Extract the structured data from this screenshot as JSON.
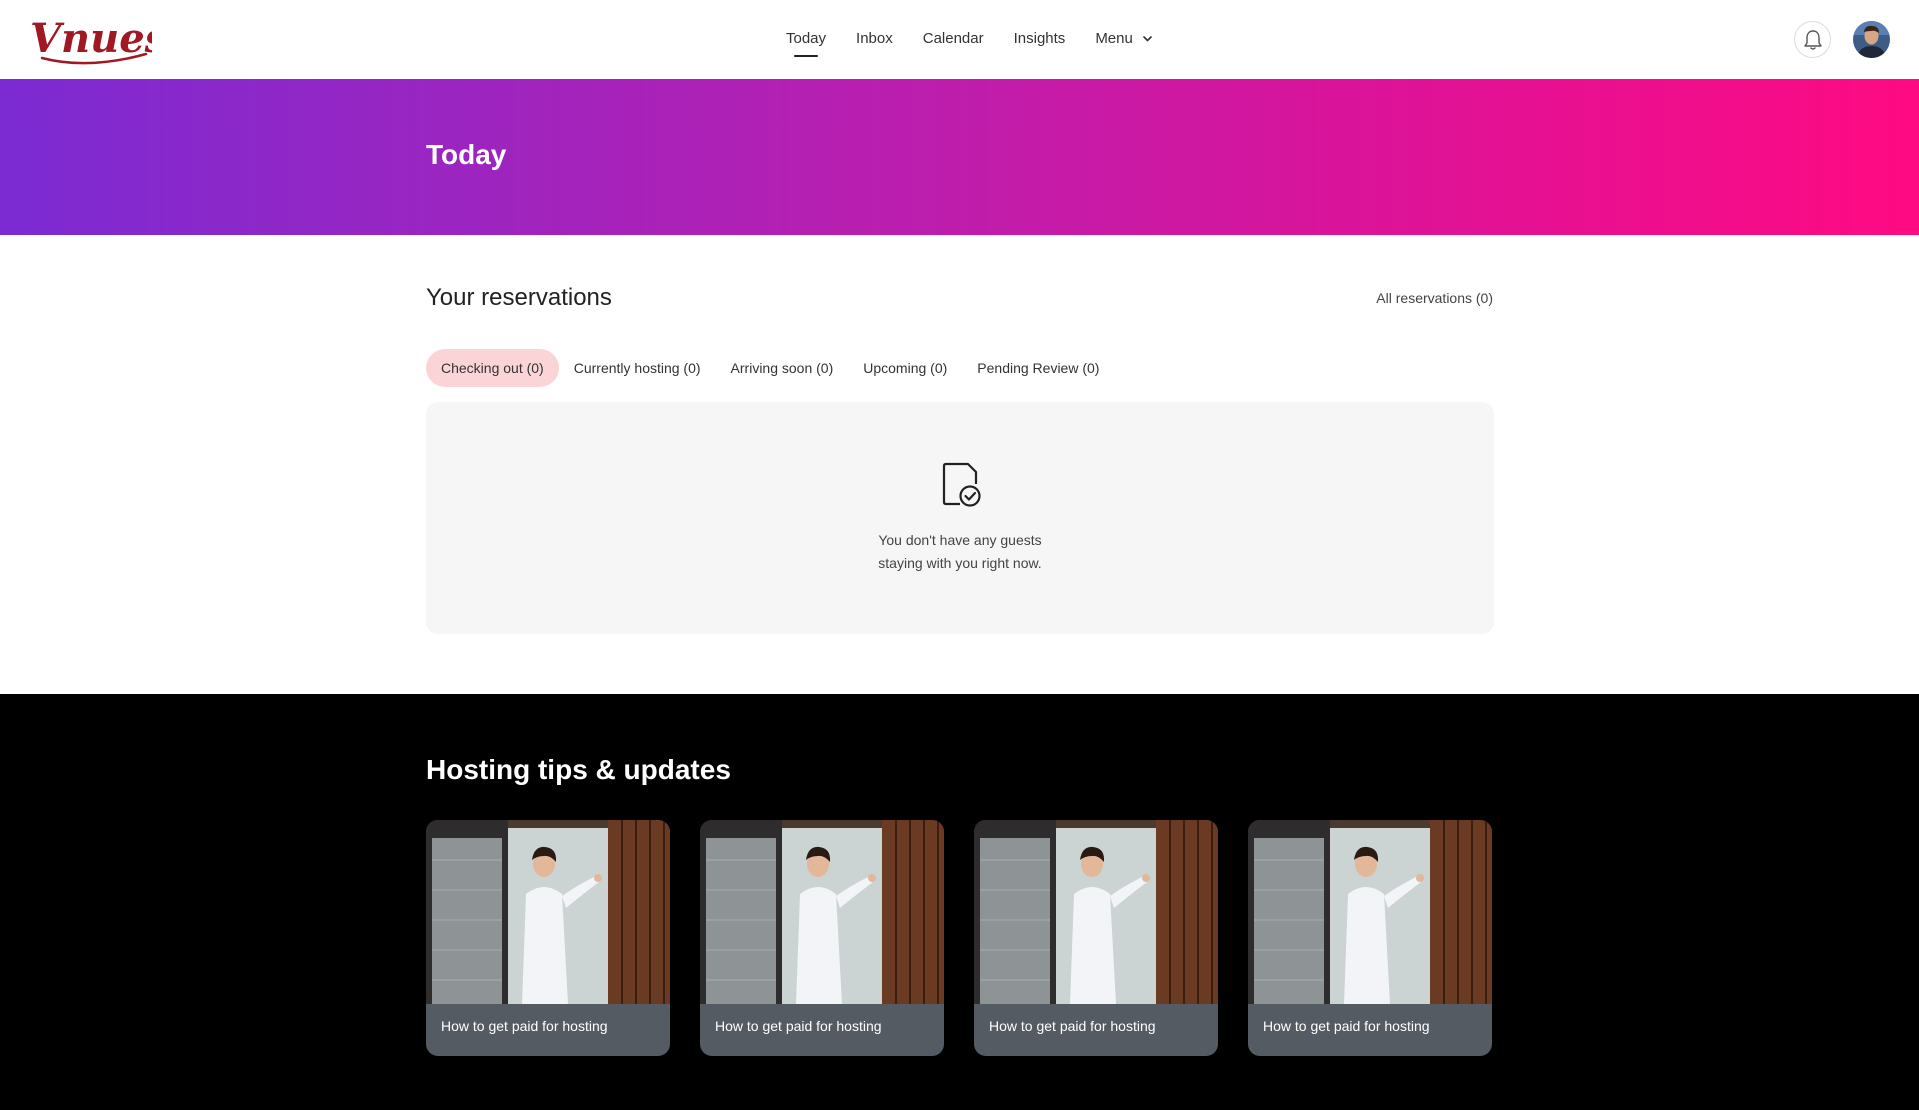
{
  "app": {
    "logo_text": "Vnues",
    "brand_color": "#a01822"
  },
  "nav": {
    "items": [
      {
        "label": "Today"
      },
      {
        "label": "Inbox"
      },
      {
        "label": "Calendar"
      },
      {
        "label": "Insights"
      },
      {
        "label": "Menu"
      }
    ],
    "active": "Today"
  },
  "hero": {
    "title": "Today"
  },
  "reservations": {
    "title": "Your reservations",
    "all_link": "All reservations (0)",
    "tabs": [
      {
        "label": "Checking out (0)"
      },
      {
        "label": "Currently hosting (0)"
      },
      {
        "label": "Arriving soon (0)"
      },
      {
        "label": "Upcoming (0)"
      },
      {
        "label": "Pending Review (0)"
      }
    ],
    "active_tab": "Checking out (0)",
    "empty_line1": "You don't have any guests",
    "empty_line2": "staying with you right now."
  },
  "tips": {
    "title": "Hosting tips & updates",
    "cards": [
      {
        "label": "How to get paid for hosting"
      },
      {
        "label": "How to get paid for hosting"
      },
      {
        "label": "How to get paid for hosting"
      },
      {
        "label": "How to get paid for hosting"
      }
    ]
  },
  "icons": {
    "bell": "bell-icon",
    "chevron": "chevron-down-icon",
    "empty_state": "document-check-icon"
  }
}
